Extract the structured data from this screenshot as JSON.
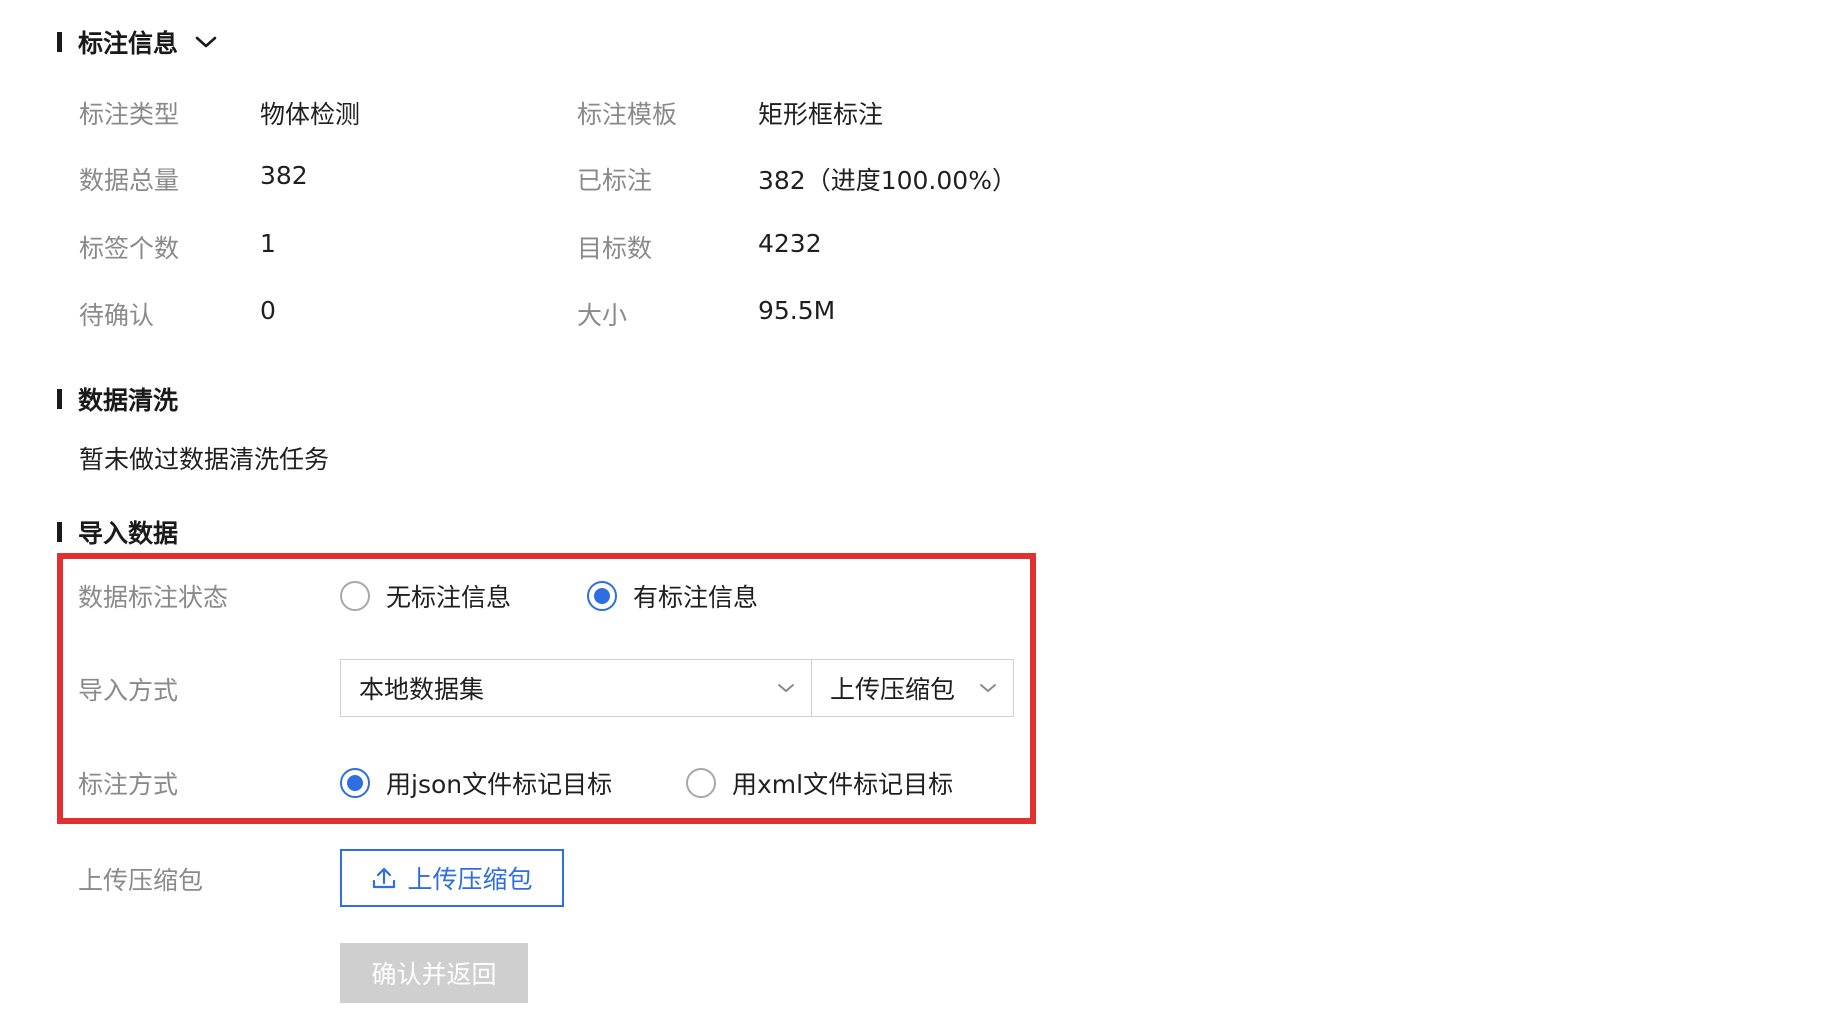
{
  "annotation_info": {
    "title": "标注信息",
    "fields": [
      {
        "label": "标注类型",
        "value": "物体检测"
      },
      {
        "label": "标注模板",
        "value": "矩形框标注"
      },
      {
        "label": "数据总量",
        "value": "382"
      },
      {
        "label": "已标注",
        "value": "382（进度100.00%）"
      },
      {
        "label": "标签个数",
        "value": "1"
      },
      {
        "label": "目标数",
        "value": "4232"
      },
      {
        "label": "待确认",
        "value": "0"
      },
      {
        "label": "大小",
        "value": "95.5M"
      }
    ]
  },
  "data_cleaning": {
    "title": "数据清洗",
    "empty_text": "暂未做过数据清洗任务"
  },
  "import_data": {
    "title": "导入数据",
    "status_label": "数据标注状态",
    "status_options": [
      {
        "label": "无标注信息",
        "checked": false
      },
      {
        "label": "有标注信息",
        "checked": true
      }
    ],
    "method_label": "导入方式",
    "method_value": "本地数据集",
    "method_sub_value": "上传压缩包",
    "annotation_method_label": "标注方式",
    "annotation_options": [
      {
        "label": "用json文件标记目标",
        "checked": true
      },
      {
        "label": "用xml文件标记目标",
        "checked": false
      }
    ],
    "upload_label": "上传压缩包",
    "upload_button": "上传压缩包",
    "confirm_button": "确认并返回"
  },
  "colors": {
    "primary": "#2e6ee0",
    "highlight_border": "#e0302f",
    "label_gray": "#8a8a8a",
    "disabled_button": "#cfcfcf"
  }
}
